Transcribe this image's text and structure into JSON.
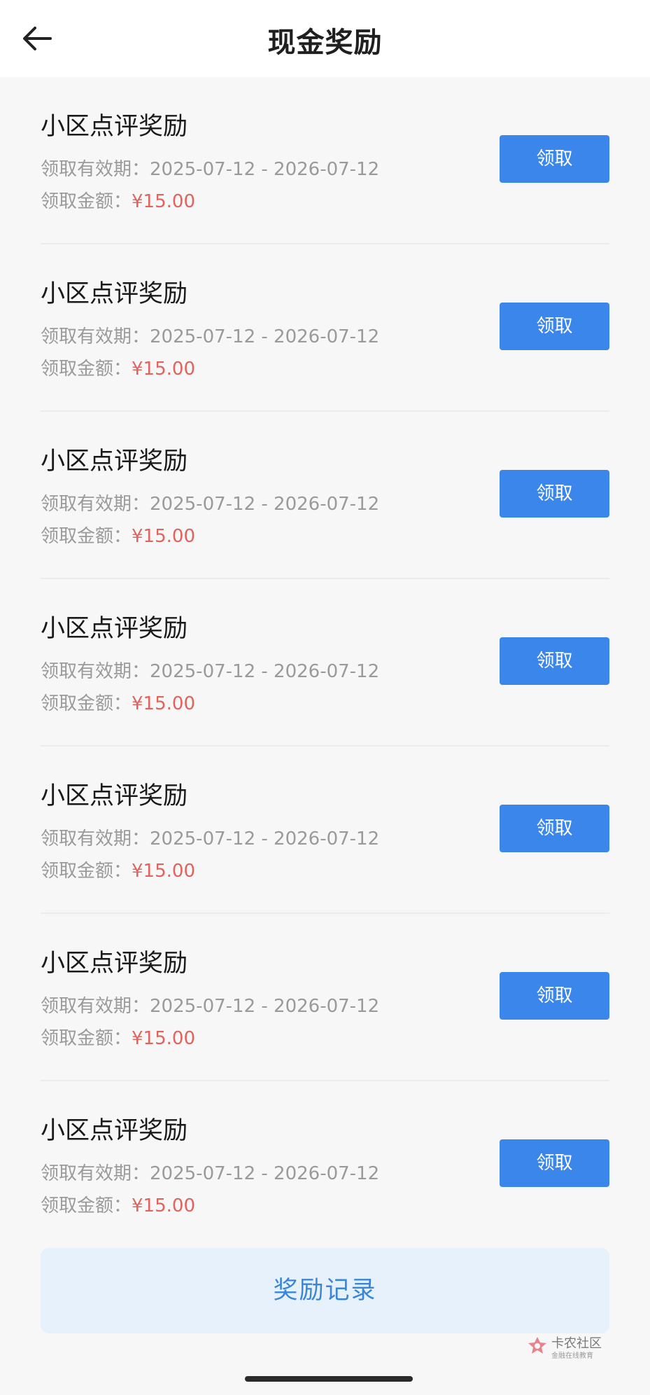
{
  "header": {
    "title": "现金奖励",
    "back_icon": "arrow-left-icon"
  },
  "rewards": [
    {
      "title": "小区点评奖励",
      "validity_label": "领取有效期：",
      "validity_range": "2025-07-12 - 2026-07-12",
      "amount_label": "领取金额：",
      "amount": "¥15.00",
      "button_label": "领取"
    },
    {
      "title": "小区点评奖励",
      "validity_label": "领取有效期：",
      "validity_range": "2025-07-12 - 2026-07-12",
      "amount_label": "领取金额：",
      "amount": "¥15.00",
      "button_label": "领取"
    },
    {
      "title": "小区点评奖励",
      "validity_label": "领取有效期：",
      "validity_range": "2025-07-12 - 2026-07-12",
      "amount_label": "领取金额：",
      "amount": "¥15.00",
      "button_label": "领取"
    },
    {
      "title": "小区点评奖励",
      "validity_label": "领取有效期：",
      "validity_range": "2025-07-12 - 2026-07-12",
      "amount_label": "领取金额：",
      "amount": "¥15.00",
      "button_label": "领取"
    },
    {
      "title": "小区点评奖励",
      "validity_label": "领取有效期：",
      "validity_range": "2025-07-12 - 2026-07-12",
      "amount_label": "领取金额：",
      "amount": "¥15.00",
      "button_label": "领取"
    },
    {
      "title": "小区点评奖励",
      "validity_label": "领取有效期：",
      "validity_range": "2025-07-12 - 2026-07-12",
      "amount_label": "领取金额：",
      "amount": "¥15.00",
      "button_label": "领取"
    },
    {
      "title": "小区点评奖励",
      "validity_label": "领取有效期：",
      "validity_range": "2025-07-12 - 2026-07-12",
      "amount_label": "领取金额：",
      "amount": "¥15.00",
      "button_label": "领取"
    }
  ],
  "footer": {
    "record_button_label": "奖励记录"
  },
  "watermark": {
    "name": "卡农社区",
    "subtitle": "金融在线教育",
    "logo_icon": "kanong-logo-icon"
  },
  "colors": {
    "accent": "#3a86ea",
    "amount": "#e0635d",
    "record_bg": "#e6f1fc",
    "page_bg": "#f7f7f7"
  }
}
